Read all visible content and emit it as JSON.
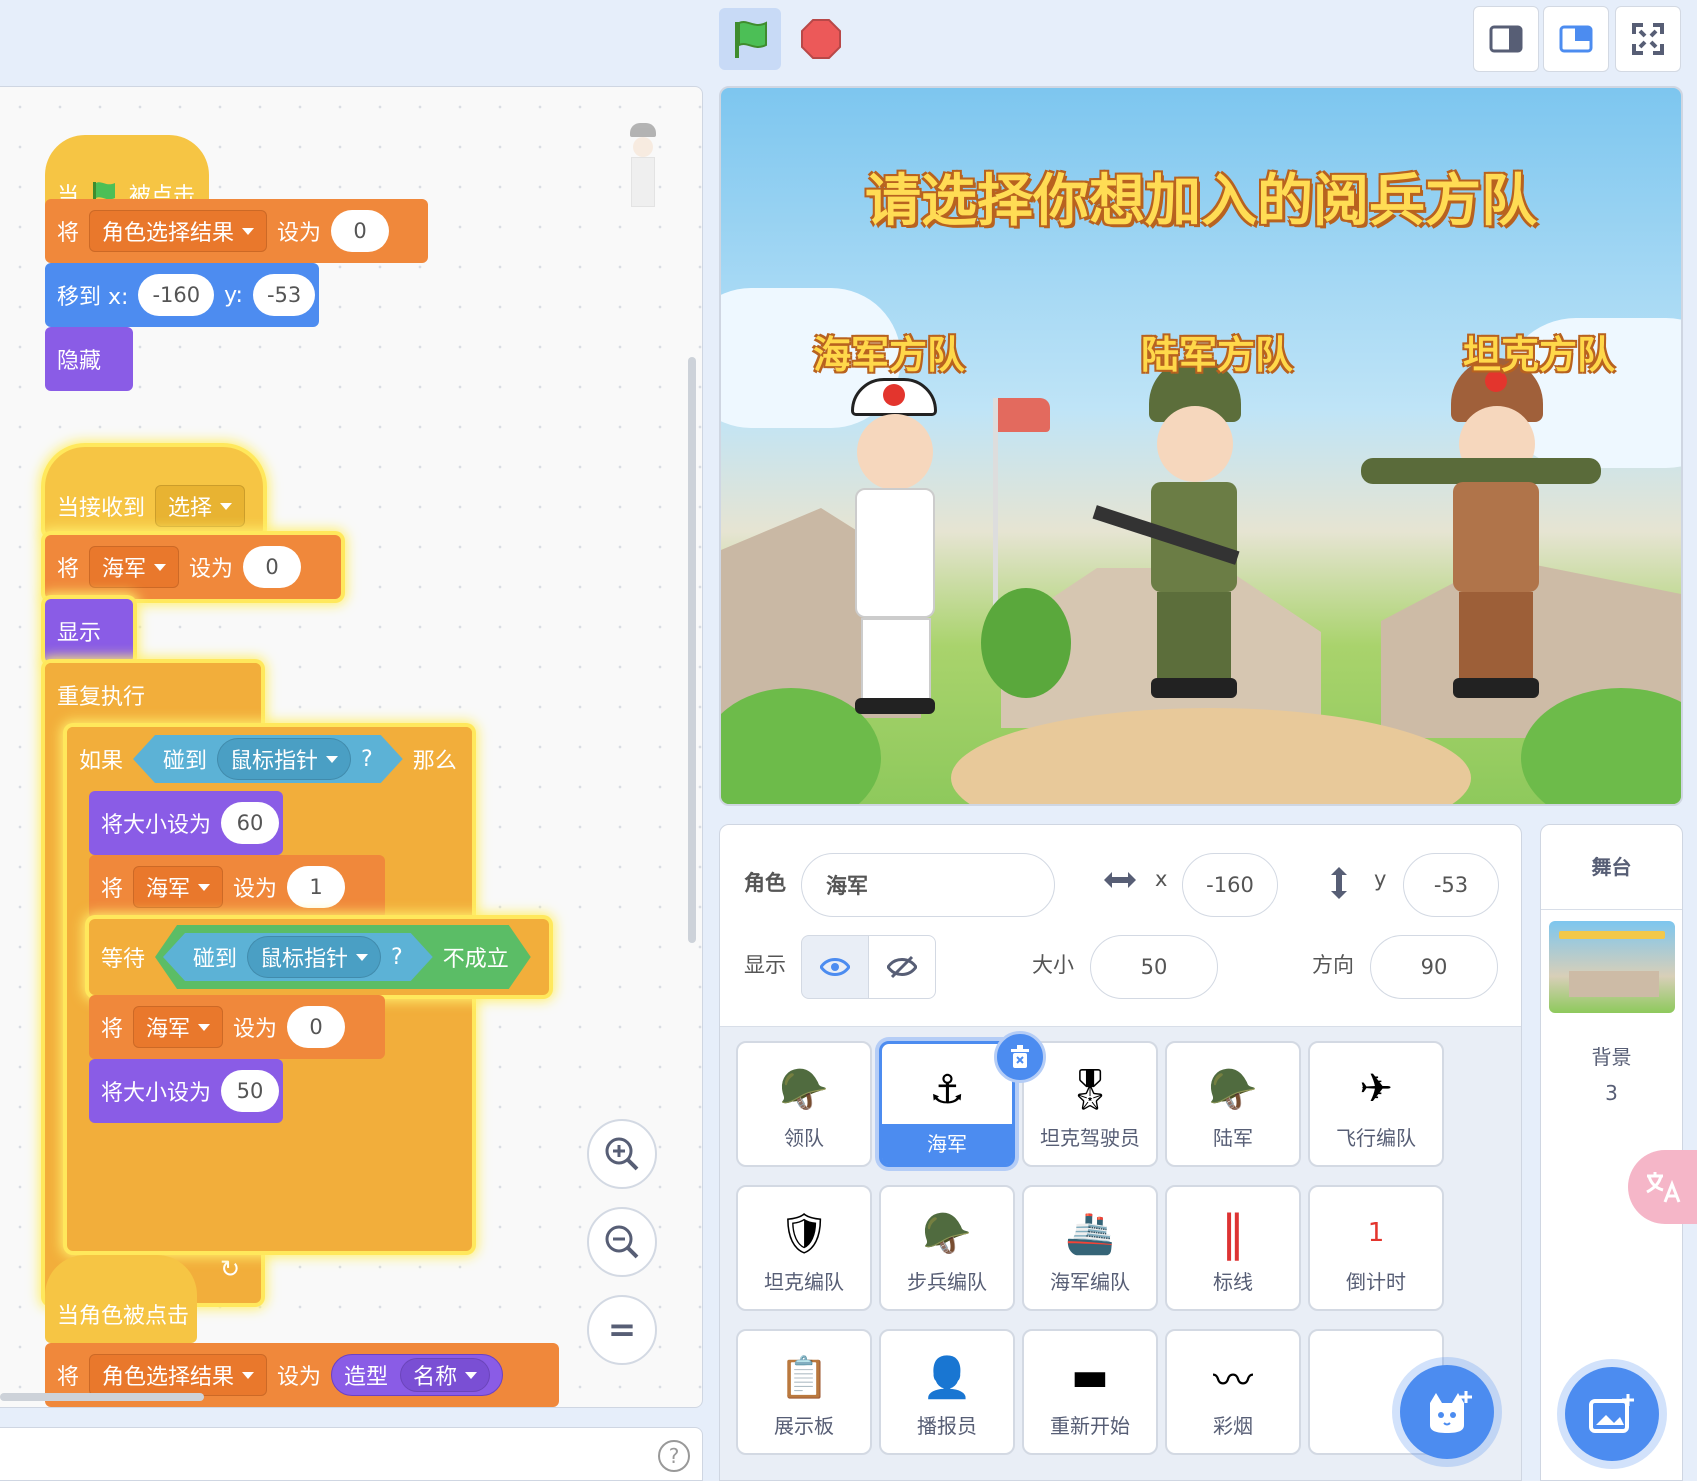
{
  "toolbar": {
    "green_flag_icon": "green-flag-icon",
    "stop_icon": "stop-icon",
    "layout_small_icon": "small-stage-icon",
    "layout_normal_icon": "normal-stage-icon",
    "fullscreen_icon": "fullscreen-icon"
  },
  "scripts": {
    "s1": {
      "hat_when": "当",
      "hat_clicked": "被点击",
      "set1_label": "将",
      "set1_var": "角色选择结果",
      "set1_to": "设为",
      "set1_value": "0",
      "goto_label": "移到 x:",
      "goto_x": "-160",
      "goto_y_label": "y:",
      "goto_y": "-53",
      "hide": "隐藏"
    },
    "s2": {
      "hat": "当接收到",
      "hat_msg": "选择",
      "set_label": "将",
      "set_var": "海军",
      "set_to": "设为",
      "set_value": "0",
      "show": "显示",
      "forever": "重复执行",
      "if": "如果",
      "touching": "碰到",
      "touch_target": "鼠标指针",
      "question": "?",
      "then": "那么",
      "setsize1_label": "将大小设为",
      "setsize1_value": "60",
      "set2_label": "将",
      "set2_var": "海军",
      "set2_to": "设为",
      "set2_value": "1",
      "wait": "等待",
      "wait_touching": "碰到",
      "wait_target": "鼠标指针",
      "wait_question": "?",
      "not": "不成立",
      "set3_label": "将",
      "set3_var": "海军",
      "set3_to": "设为",
      "set3_value": "0",
      "setsize2_label": "将大小设为",
      "setsize2_value": "50",
      "loop_arrow": "↻"
    },
    "s3": {
      "hat": "当角色被点击",
      "set_label": "将",
      "set_var": "角色选择结果",
      "set_to": "设为",
      "costume": "造型",
      "costume_prop": "名称"
    }
  },
  "zoom": {
    "zoom_in": "+",
    "zoom_out": "−",
    "reset": "="
  },
  "help": "?",
  "stage": {
    "title": "请选择你想加入的阅兵方队",
    "navy_label": "海军方队",
    "army_label": "陆军方队",
    "tank_label": "坦克方队"
  },
  "sprite_info": {
    "sprite_label": "角色",
    "sprite_name": "海军",
    "x_label": "x",
    "x_value": "-160",
    "y_label": "y",
    "y_value": "-53",
    "show_label": "显示",
    "size_label": "大小",
    "size_value": "50",
    "direction_label": "方向",
    "direction_value": "90"
  },
  "sprites": [
    {
      "name": "领队",
      "icon": "🪖"
    },
    {
      "name": "海军",
      "icon": "⚓"
    },
    {
      "name": "坦克驾驶员",
      "icon": "🎖"
    },
    {
      "name": "陆军",
      "icon": "🪖"
    },
    {
      "name": "飞行编队",
      "icon": "✈"
    },
    {
      "name": "坦克编队",
      "icon": "🛡"
    },
    {
      "name": "步兵编队",
      "icon": "🪖"
    },
    {
      "name": "海军编队",
      "icon": "🚢"
    },
    {
      "name": "标线",
      "icon": "‖"
    },
    {
      "name": "倒计时",
      "icon": "1"
    },
    {
      "name": "展示板",
      "icon": "📋"
    },
    {
      "name": "播报员",
      "icon": "👤"
    },
    {
      "name": "重新开始",
      "icon": "▬"
    },
    {
      "name": "彩烟",
      "icon": "〰"
    },
    {
      "name": "",
      "icon": ""
    }
  ],
  "stage_pane": {
    "title": "舞台",
    "backdrop_label": "背景",
    "backdrop_count": "3"
  },
  "colors": {
    "accent": "#4c8cf0",
    "events": "#f6c544",
    "variables": "#f0883b",
    "motion": "#4d8cf0",
    "looks": "#8a5ce6",
    "control": "#f2ae3b",
    "sensing": "#5cb2d6",
    "operators": "#5bbd66"
  }
}
